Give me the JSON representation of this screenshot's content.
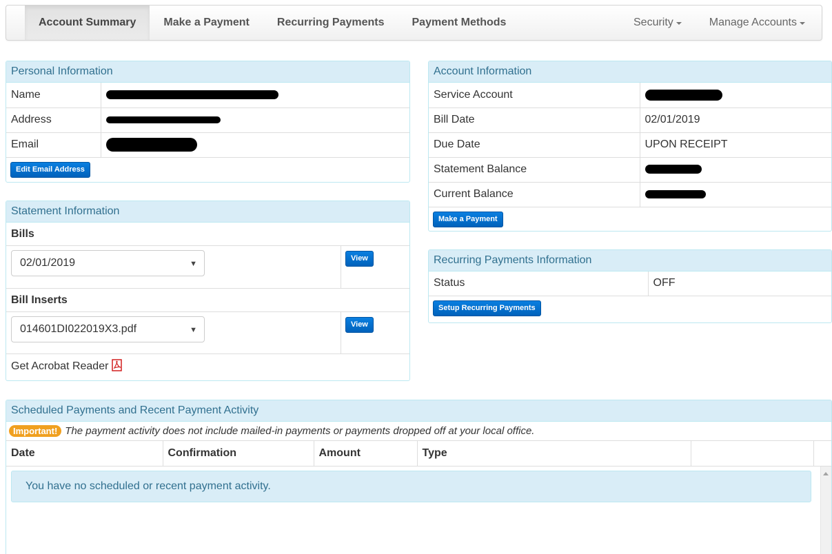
{
  "nav": {
    "tabs": [
      "Account Summary",
      "Make a Payment",
      "Recurring Payments",
      "Payment Methods"
    ],
    "security": "Security",
    "manage": "Manage Accounts"
  },
  "personal": {
    "title": "Personal Information",
    "name_label": "Name",
    "address_label": "Address",
    "email_label": "Email",
    "edit_email_button": "Edit Email Address"
  },
  "statement": {
    "title": "Statement Information",
    "bills_label": "Bills",
    "bills_selected": "02/01/2019",
    "view_label": "View",
    "inserts_label": "Bill Inserts",
    "inserts_selected": "014601DI022019X3.pdf",
    "acrobat_text": "Get Acrobat Reader"
  },
  "account": {
    "title": "Account Information",
    "service_account_label": "Service Account",
    "bill_date_label": "Bill Date",
    "bill_date_value": "02/01/2019",
    "due_date_label": "Due Date",
    "due_date_value": "UPON RECEIPT",
    "statement_balance_label": "Statement Balance",
    "current_balance_label": "Current Balance",
    "make_payment_button": "Make a Payment"
  },
  "recurring": {
    "title": "Recurring Payments Information",
    "status_label": "Status",
    "status_value": "OFF",
    "setup_button": "Setup Recurring Payments"
  },
  "scheduled": {
    "title": "Scheduled Payments and Recent Payment Activity",
    "badge": "Important!",
    "notice": "The payment activity does not include mailed-in payments or payments dropped off at your local office.",
    "columns": [
      "Date",
      "Confirmation",
      "Amount",
      "Type",
      ""
    ],
    "empty_message": "You have no scheduled or recent payment activity."
  },
  "colors": {
    "panel_heading_bg": "#d9edf7",
    "panel_heading_text": "#31708f",
    "button_blue": "#0a6fd0",
    "status_off": "#ff0000",
    "badge_orange": "#f0a020"
  },
  "icons": [
    "caret-down-icon",
    "pdf-icon",
    "select-arrow-icon",
    "scroll-up-icon"
  ]
}
